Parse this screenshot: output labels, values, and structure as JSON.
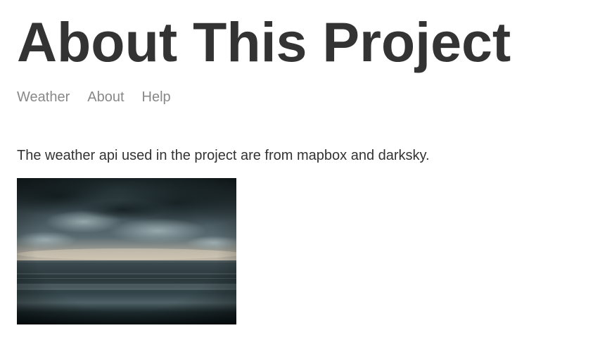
{
  "header": {
    "title": "About This Project"
  },
  "nav": {
    "items": [
      {
        "label": "Weather"
      },
      {
        "label": "About"
      },
      {
        "label": "Help"
      }
    ]
  },
  "main": {
    "description": "The weather api used in the project are from mapbox and darksky.",
    "image": {
      "subject": "stormy-sea-photo"
    }
  },
  "colors": {
    "title": "#333333",
    "nav_link": "#888888",
    "body_text": "#333333",
    "background": "#ffffff"
  }
}
